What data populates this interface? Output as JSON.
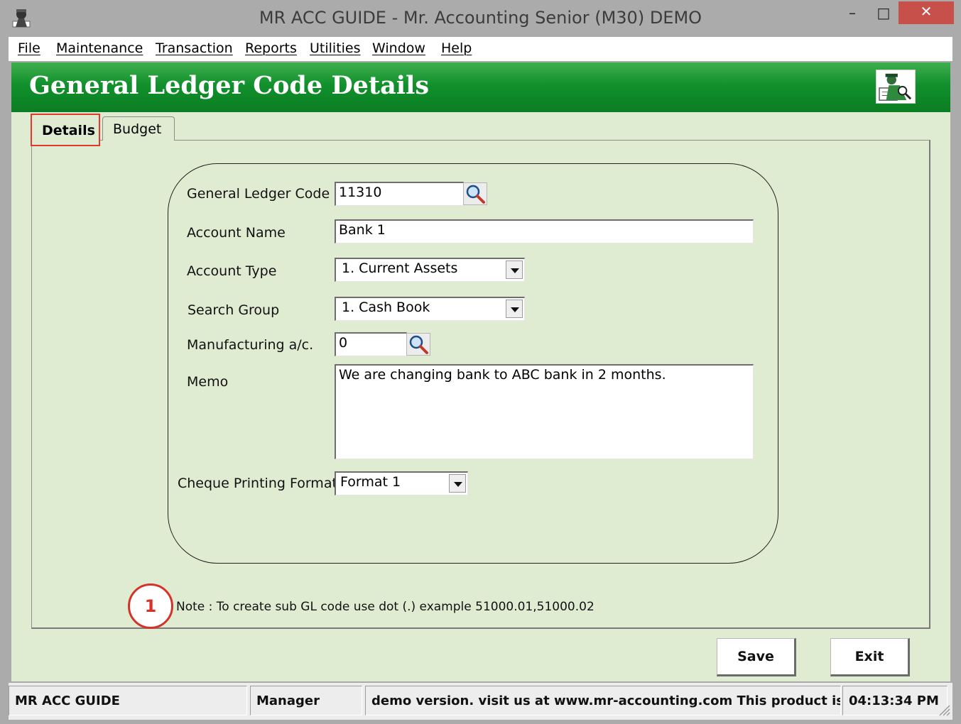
{
  "window": {
    "title": "MR ACC GUIDE - Mr. Accounting Senior (M30) DEMO",
    "controls": {
      "minimize": "–",
      "maximize": "□",
      "close": "✕"
    }
  },
  "menu": [
    {
      "label": "File"
    },
    {
      "label": "Maintenance"
    },
    {
      "label": "Transaction"
    },
    {
      "label": "Reports"
    },
    {
      "label": "Utilities"
    },
    {
      "label": "Window"
    },
    {
      "label": "Help"
    }
  ],
  "header": {
    "title": "General Ledger Code Details"
  },
  "tabs": [
    {
      "label": "Details",
      "active": true
    },
    {
      "label": "Budget",
      "active": false
    }
  ],
  "form": {
    "gl_code": {
      "label": "General Ledger Code",
      "value": "11310"
    },
    "account_name": {
      "label": "Account Name",
      "value": "Bank 1"
    },
    "account_type": {
      "label": "Account Type",
      "value": "1. Current Assets"
    },
    "search_group": {
      "label": "Search Group",
      "value": "1. Cash Book"
    },
    "manufacturing": {
      "label": "Manufacturing a/c.",
      "value": "0"
    },
    "memo": {
      "label": "Memo",
      "value": "We are changing bank to ABC bank in 2 months."
    },
    "cheque_format": {
      "label": "Cheque Printing Format",
      "value": "Format 1"
    }
  },
  "note": {
    "marker": "1",
    "text": "Note : To create sub GL code use dot (.) example 51000.01,51000.02"
  },
  "buttons": {
    "save": "Save",
    "exit": "Exit"
  },
  "status": {
    "app": "MR ACC GUIDE",
    "user": "Manager",
    "message": "demo version.  visit us at www.mr-accounting.com This product is",
    "time": "04:13:34 PM"
  },
  "colors": {
    "header_green": "#11902c",
    "client_bg": "#e0ecd2",
    "highlight_red": "#d4332a",
    "close_button": "#c7504b"
  }
}
